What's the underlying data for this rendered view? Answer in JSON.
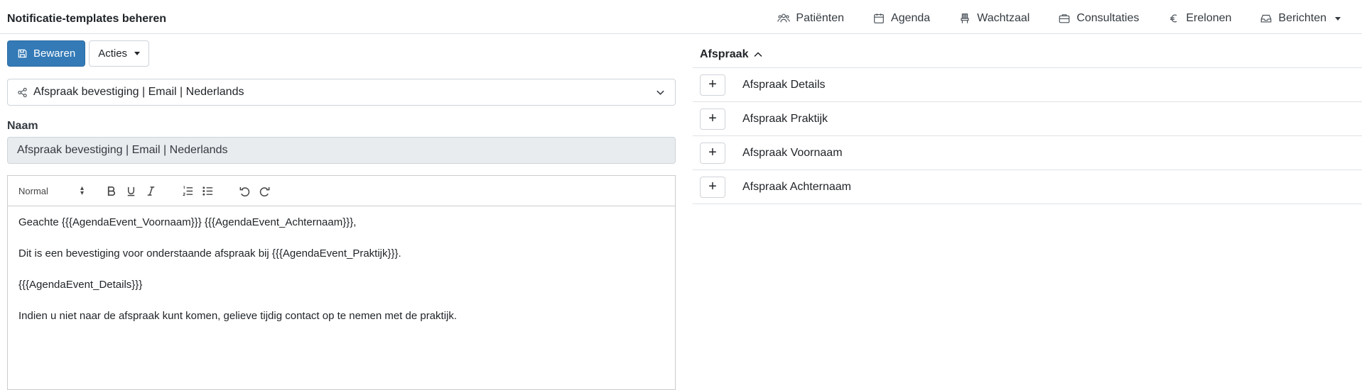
{
  "header": {
    "title": "Notificatie-templates beheren",
    "nav": [
      {
        "label": "Patiënten",
        "icon": "users-icon"
      },
      {
        "label": "Agenda",
        "icon": "calendar-icon"
      },
      {
        "label": "Wachtzaal",
        "icon": "chair-icon"
      },
      {
        "label": "Consultaties",
        "icon": "briefcase-icon"
      },
      {
        "label": "Erelonen",
        "icon": "euro-icon"
      },
      {
        "label": "Berichten",
        "icon": "inbox-icon"
      }
    ]
  },
  "actions": {
    "save_label": "Bewaren",
    "actions_label": "Acties"
  },
  "template_select": {
    "value": "Afspraak bevestiging | Email | Nederlands"
  },
  "form": {
    "name_label": "Naam",
    "name_value": "Afspraak bevestiging | Email | Nederlands"
  },
  "editor": {
    "format": "Normal",
    "paragraphs": [
      "Geachte {{{AgendaEvent_Voornaam}}} {{{AgendaEvent_Achternaam}}},",
      "Dit is een bevestiging voor onderstaande afspraak bij {{{AgendaEvent_Praktijk}}}.",
      "{{{AgendaEvent_Details}}}",
      "Indien u niet naar de afspraak kunt komen, gelieve tijdig contact op te nemen met de praktijk."
    ]
  },
  "variables": {
    "section_title": "Afspraak",
    "items": [
      {
        "label": "Afspraak Details"
      },
      {
        "label": "Afspraak Praktijk"
      },
      {
        "label": "Afspraak Voornaam"
      },
      {
        "label": "Afspraak Achternaam"
      }
    ]
  },
  "colors": {
    "primary": "#337ab7",
    "border": "#dee2e6",
    "readonly_bg": "#e9ecef"
  }
}
